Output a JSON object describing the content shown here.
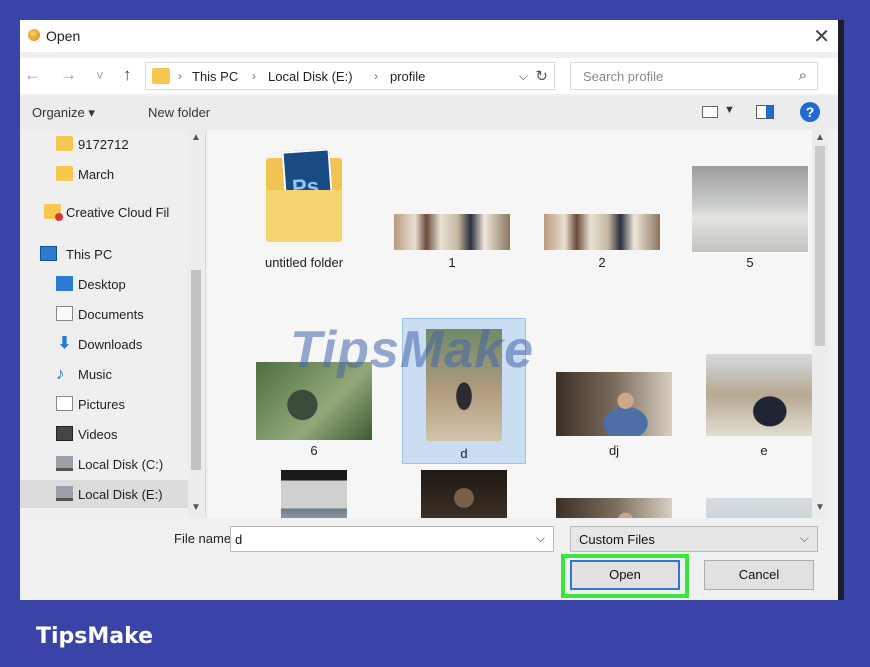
{
  "window": {
    "title": "Open",
    "close_glyph": "✕"
  },
  "nav": {
    "back_glyph": "←",
    "forward_glyph": "→",
    "recent_glyph": "˅",
    "up_glyph": "↑",
    "breadcrumbs": [
      "This PC",
      "Local Disk (E:)",
      "profile"
    ],
    "search_placeholder": "Search profile"
  },
  "toolbar": {
    "organize": "Organize ▾",
    "new_folder": "New folder",
    "help": "?"
  },
  "sidebar": {
    "items": [
      {
        "label": "9172712",
        "icon": "folder-icon"
      },
      {
        "label": "March",
        "icon": "folder-icon"
      },
      {
        "label": "Creative Cloud Fil",
        "icon": "creative-cloud-icon"
      },
      {
        "label": "This PC",
        "icon": "computer-icon"
      },
      {
        "label": "Desktop",
        "icon": "desktop-icon"
      },
      {
        "label": "Documents",
        "icon": "documents-icon"
      },
      {
        "label": "Downloads",
        "icon": "downloads-icon"
      },
      {
        "label": "Music",
        "icon": "music-icon"
      },
      {
        "label": "Pictures",
        "icon": "pictures-icon"
      },
      {
        "label": "Videos",
        "icon": "videos-icon"
      },
      {
        "label": "Local Disk (C:)",
        "icon": "disk-icon"
      },
      {
        "label": "Local Disk (E:)",
        "icon": "disk-icon",
        "selected": true
      }
    ]
  },
  "files": [
    {
      "name": "untitled folder",
      "kind": "folder"
    },
    {
      "name": "1",
      "kind": "photo"
    },
    {
      "name": "2",
      "kind": "photo"
    },
    {
      "name": "5",
      "kind": "photo"
    },
    {
      "name": "6",
      "kind": "photo"
    },
    {
      "name": "d",
      "kind": "photo",
      "selected": true
    },
    {
      "name": "dj",
      "kind": "photo"
    },
    {
      "name": "e",
      "kind": "photo"
    },
    {
      "name": "",
      "kind": "photo"
    },
    {
      "name": "",
      "kind": "photo"
    },
    {
      "name": "",
      "kind": "photo"
    },
    {
      "name": "",
      "kind": "photo"
    }
  ],
  "bottom": {
    "file_name_label": "File name:",
    "file_name_value": "d",
    "file_type": "Custom Files",
    "open_label": "Open",
    "cancel_label": "Cancel"
  },
  "watermark": "TipsMake",
  "brand": "TipsMake",
  "colors": {
    "background": "#3a43a8",
    "highlight": "#39e639",
    "accent": "#1f6bd0"
  }
}
